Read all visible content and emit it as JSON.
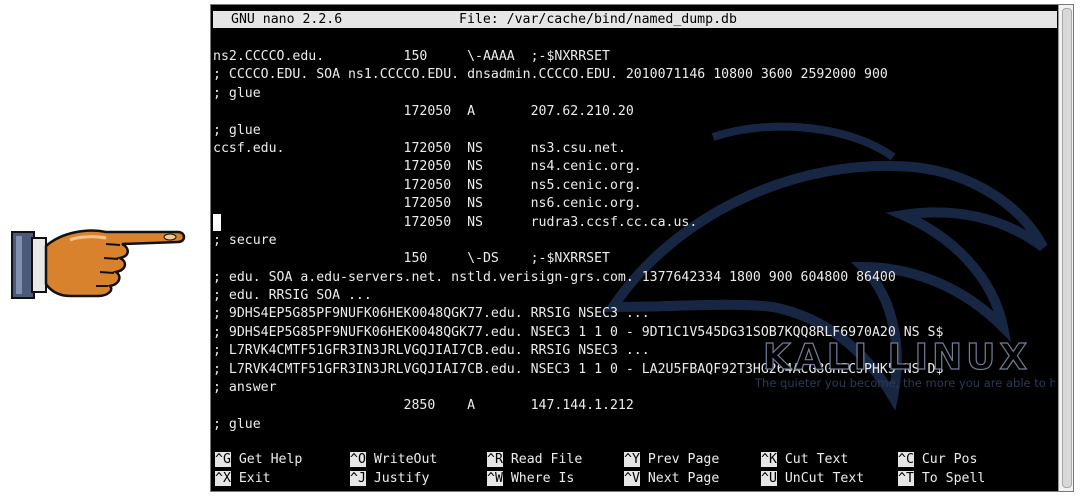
{
  "titlebar": {
    "version": "GNU nano 2.2.6",
    "file": "File: /var/cache/bind/named_dump.db"
  },
  "lines": [
    {
      "text": "ns2.CCCCO.edu.          150     \\-AAAA  ;-$NXRRSET"
    },
    {
      "text": "; CCCCO.EDU. SOA ns1.CCCCO.EDU. dnsadmin.CCCCO.EDU. 2010071146 10800 3600 2592000 900"
    },
    {
      "text": "; glue"
    },
    {
      "text": "                        172050  A       207.62.210.20"
    },
    {
      "text": "; glue"
    },
    {
      "text": "ccsf.edu.               172050  NS      ns3.csu.net."
    },
    {
      "text": "                        172050  NS      ns4.cenic.org."
    },
    {
      "text": "                        172050  NS      ns5.cenic.org."
    },
    {
      "text": "                        172050  NS      ns6.cenic.org."
    },
    {
      "text": "                        172050  NS      rudra3.ccsf.cc.ca.us.",
      "cursor": true
    },
    {
      "text": "; secure"
    },
    {
      "text": "                        150     \\-DS    ;-$NXRRSET"
    },
    {
      "text": "; edu. SOA a.edu-servers.net. nstld.verisign-grs.com. 1377642334 1800 900 604800 86400"
    },
    {
      "text": "; edu. RRSIG SOA ..."
    },
    {
      "text": "; 9DHS4EP5G85PF9NUFK06HEK0048QGK77.edu. RRSIG NSEC3 ..."
    },
    {
      "text": "; 9DHS4EP5G85PF9NUFK06HEK0048QGK77.edu. NSEC3 1 1 0 - 9DT1C1V545DG31SOB7KQQ8RLF6970A20 NS S$"
    },
    {
      "text": "; L7RVK4CMTF51GFR3IN3JRLVGQJIAI7CB.edu. RRSIG NSEC3 ..."
    },
    {
      "text": "; L7RVK4CMTF51GFR3IN3JRLVGQJIAI7CB.edu. NSEC3 1 1 0 - LA2U5FBAQF92T3HG264ACG8GHECJPHK5 NS D$"
    },
    {
      "text": "; answer"
    },
    {
      "text": "                        2850    A       147.144.1.212"
    },
    {
      "text": "; glue"
    }
  ],
  "shortcuts_row1": [
    {
      "key": "^G",
      "label": " Get Help"
    },
    {
      "key": "^O",
      "label": " WriteOut"
    },
    {
      "key": "^R",
      "label": " Read File"
    },
    {
      "key": "^Y",
      "label": " Prev Page"
    },
    {
      "key": "^K",
      "label": " Cut Text"
    },
    {
      "key": "^C",
      "label": " Cur Pos"
    }
  ],
  "shortcuts_row2": [
    {
      "key": "^X",
      "label": " Exit"
    },
    {
      "key": "^J",
      "label": " Justify"
    },
    {
      "key": "^W",
      "label": " Where Is"
    },
    {
      "key": "^V",
      "label": " Next Page"
    },
    {
      "key": "^U",
      "label": " UnCut Text"
    },
    {
      "key": "^T",
      "label": " To Spell"
    }
  ],
  "wallpaper": {
    "logo_text": "KALI LINUX",
    "tagline": "The quieter you become, the more you are able to hear."
  }
}
